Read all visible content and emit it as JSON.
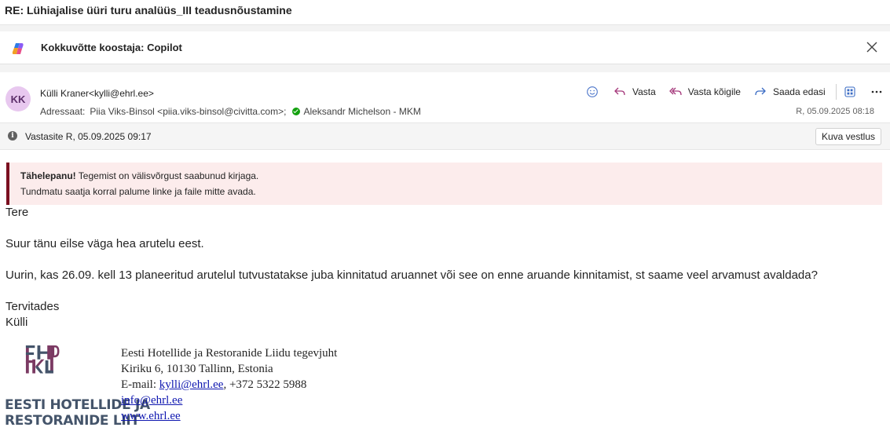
{
  "subject": "RE: Lühiajalise üüri turu analüüs_III teadusnõustamine",
  "copilot": {
    "title": "Kokkuvõtte koostaja: Copilot"
  },
  "message": {
    "avatar_initials": "KK",
    "sender": "Külli Kraner<kylli@ehrl.ee>",
    "to_label": "Adressaat:",
    "recipient1": "Piia Viks-Binsol <piia.viks-binsol@civitta.com>;",
    "recipient2": "Aleksandr Michelson - MKM",
    "datetime": "R, 05.09.2025 08:18",
    "actions": {
      "reply": "Vasta",
      "reply_all": "Vasta kõigile",
      "forward": "Saada edasi"
    }
  },
  "info_bar": {
    "text": "Vastasite R, 05.09.2025 09:17",
    "button": "Kuva vestlus"
  },
  "warning": {
    "bold": "Tähelepanu!",
    "line1": " Tegemist on välisvõrgust saabunud kirjaga.",
    "line2": "Tundmatu saatja korral palume linke ja faile mitte avada."
  },
  "body": {
    "greeting": "Tere",
    "p1": "Suur tänu eilse väga hea arutelu eest.",
    "p2": "Uurin, kas 26.09. kell 13 planeeritud arutelul tutvustatakse juba kinnitatud aruannet või see on enne aruande kinnitamist, st saame veel arvamust avaldada?",
    "closing": "Tervitades",
    "name": "Külli"
  },
  "signature": {
    "logo_line1": "EESTI HOTELLIDE JA",
    "logo_line2": "RESTORANIDE LIIT",
    "title": "Eesti Hotellide ja Restoranide Liidu tegevjuht",
    "address": "Kiriku 6, 10130 Tallinn, Estonia",
    "email_label": "E-mail: ",
    "email": "kylli@ehrl.ee",
    "phone": ", +372 5322 5988",
    "info_email": "info@ehrl.ee",
    "website": "www.ehrl.ee"
  },
  "colors": {
    "warning_bg": "#fcecec",
    "warning_border": "#7b1020",
    "link": "#0f17b0",
    "logo_purple": "#7b3a63",
    "logo_slate": "#44546a"
  }
}
